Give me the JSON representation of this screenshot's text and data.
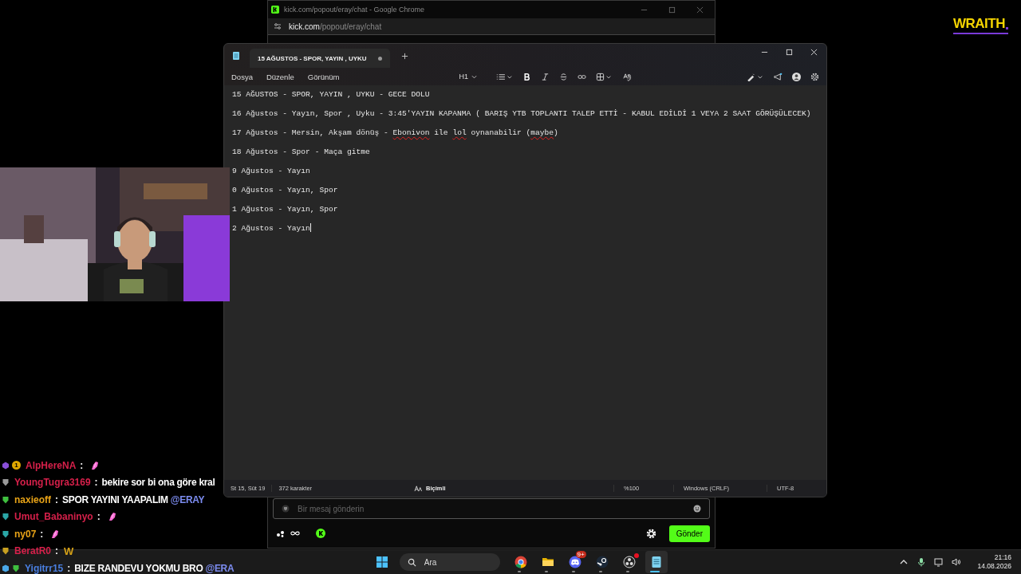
{
  "logo": {
    "text": "WRAITH"
  },
  "browser": {
    "title": "kick.com/popout/eray/chat - Google Chrome",
    "url_host": "kick.com",
    "url_path": "/popout/eray/chat",
    "message_placeholder": "Bir mesaj gönderin",
    "send_button": "Gönder"
  },
  "notepad": {
    "tab": {
      "title": "15 AĞUSTOS - SPOR, YAYIN , UYKU",
      "unsaved": true
    },
    "menu": [
      "Dosya",
      "Düzenle",
      "Görünüm"
    ],
    "heading_button": "H1",
    "lines": [
      {
        "segments": [
          {
            "text": "15 AĞUSTOS - SPOR, YAYIN , UYKU - GECE DOLU",
            "misspelled": false
          }
        ]
      },
      {
        "segments": [
          {
            "text": "16 Ağustos - Yayın, Spor , Uyku - 3:45'YAYIN KAPANMA ( BARIŞ YTB TOPLANTI TALEP ETTİ - KABUL EDİLDİ 1 VEYA 2 SAAT GÖRÜŞÜLECEK)",
            "misspelled": false
          }
        ]
      },
      {
        "segments": [
          {
            "text": "17 Ağustos - Mersin, Akşam dönüş - ",
            "misspelled": false
          },
          {
            "text": "Ebonivon",
            "misspelled": true
          },
          {
            "text": " ile ",
            "misspelled": false
          },
          {
            "text": "lol",
            "misspelled": true
          },
          {
            "text": " oynanabilir (",
            "misspelled": false
          },
          {
            "text": "maybe",
            "misspelled": true
          },
          {
            "text": ")",
            "misspelled": false
          }
        ]
      },
      {
        "segments": [
          {
            "text": "18 Ağustos - Spor - Maça gitme",
            "misspelled": false
          }
        ]
      },
      {
        "segments": [
          {
            "text": "9 Ağustos - Yayın",
            "misspelled": false
          }
        ]
      },
      {
        "segments": [
          {
            "text": "0 Ağustos - Yayın, Spor",
            "misspelled": false
          }
        ]
      },
      {
        "segments": [
          {
            "text": "1 Ağustos - Yayın, Spor",
            "misspelled": false
          }
        ]
      },
      {
        "segments": [
          {
            "text": "2 Ağustos - Yayın",
            "misspelled": false
          }
        ]
      }
    ],
    "status": {
      "position": "St 15, Süt 19",
      "characters": "372 karakter",
      "format": "Biçimli",
      "zoom": "%100",
      "line_endings": "Windows (CRLF)",
      "encoding": "UTF-8"
    }
  },
  "chat": [
    {
      "badges": [
        {
          "kind": "gem",
          "color": "#8a4fd8"
        },
        {
          "kind": "coin",
          "label": "1",
          "color": "#e0a800"
        }
      ],
      "user": "AlpHereNA",
      "color": "#d6204a",
      "separator": ":",
      "message": {
        "kind": "emote"
      }
    },
    {
      "badges": [
        {
          "kind": "shield",
          "color": "#9a9a9a"
        }
      ],
      "user": "YoungTugra3169",
      "color": "#d6204a",
      "separator": ":",
      "message": {
        "kind": "text",
        "text": "bekire sor bi ona göre kral"
      }
    },
    {
      "badges": [
        {
          "kind": "shield",
          "color": "#3fbf3f"
        }
      ],
      "user": "naxieoff",
      "color": "#e8a317",
      "separator": ":",
      "message": {
        "kind": "text",
        "text": "SPOR YAYINI YAAPALIM",
        "mention": "@ERAY"
      }
    },
    {
      "badges": [
        {
          "kind": "shield",
          "color": "#2aa6a6"
        }
      ],
      "user": "Umut_Babaninyo",
      "color": "#d6204a",
      "separator": ":",
      "message": {
        "kind": "emote"
      }
    },
    {
      "badges": [
        {
          "kind": "shield",
          "color": "#2aa6a6"
        }
      ],
      "user": "ny07",
      "color": "#e8a317",
      "separator": ":",
      "message": {
        "kind": "emote"
      }
    },
    {
      "badges": [
        {
          "kind": "shield",
          "color": "#c8a020"
        }
      ],
      "user": "BeratR0",
      "color": "#d6204a",
      "separator": ":",
      "message": {
        "kind": "glyph",
        "text": "W"
      }
    },
    {
      "badges": [
        {
          "kind": "cube",
          "color": "#4aa8e8"
        },
        {
          "kind": "shield",
          "color": "#3fbf3f"
        }
      ],
      "user": "Yigitrr15",
      "color": "#4a7fe0",
      "separator": ":",
      "message": {
        "kind": "text",
        "text": "BIZE RANDEVU YOKMU BRO",
        "mention": "@ERA"
      }
    }
  ],
  "taskbar": {
    "search_placeholder": "Ara",
    "apps": [
      {
        "kind": "chrome",
        "selected": false
      },
      {
        "kind": "folder",
        "selected": false
      },
      {
        "kind": "discord",
        "selected": false,
        "badge": "9+"
      },
      {
        "kind": "steam",
        "selected": false
      },
      {
        "kind": "recorder",
        "selected": false,
        "alert": true
      },
      {
        "kind": "notepad",
        "selected": true
      }
    ],
    "time": "21:16",
    "date": "14.08.2026"
  }
}
